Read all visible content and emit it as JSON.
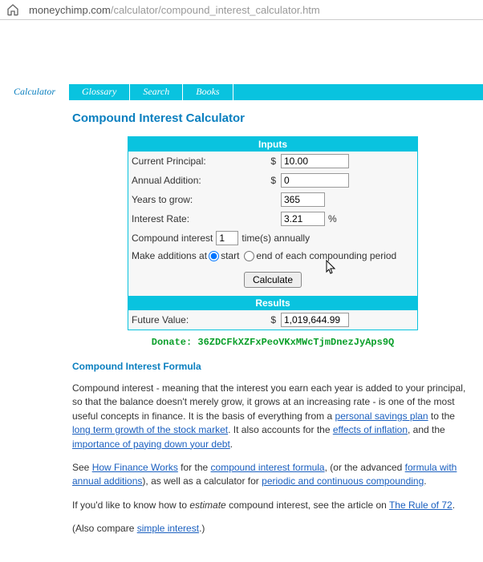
{
  "url": {
    "host": "moneychimp.com",
    "path": "/calculator/compound_interest_calculator.htm"
  },
  "nav": {
    "items": [
      "Calculator",
      "Glossary",
      "Search",
      "Books"
    ],
    "active": 0
  },
  "title": "Compound Interest Calculator",
  "inputs_header": "Inputs",
  "results_header": "Results",
  "fields": {
    "principal": {
      "label": "Current Principal:",
      "sym": "$",
      "value": "10.00"
    },
    "addition": {
      "label": "Annual Addition:",
      "sym": "$",
      "value": "0"
    },
    "years": {
      "label": "Years to grow:",
      "value": "365"
    },
    "rate": {
      "label": "Interest Rate:",
      "value": "3.21",
      "suffix": "%"
    },
    "compound": {
      "label": "Compound interest",
      "value": "1",
      "suffix": "time(s) annually"
    },
    "timing": {
      "label": "Make additions at",
      "start": "start",
      "end": "end of each compounding period"
    }
  },
  "calculate_label": "Calculate",
  "future": {
    "label": "Future Value:",
    "sym": "$",
    "value": "1,019,644.99"
  },
  "donate": "Donate: 36ZDCFkXZFxPeoVKxMWcTjmDnezJyAps9Q",
  "formula_title": "Compound Interest Formula",
  "para1": {
    "a": "Compound interest - meaning that the interest you earn each year is added to your principal, so that the balance doesn't merely grow, it grows at an increasing rate - is one of the most useful concepts in finance. It is the basis of everything from a ",
    "link1": "personal savings plan",
    "b": " to the ",
    "link2": "long term growth of the stock market",
    "c": ". It also accounts for the ",
    "link3": "effects of inflation",
    "d": ", and the ",
    "link4": "importance of paying down your debt",
    "e": "."
  },
  "para2": {
    "a": "See ",
    "link1": "How Finance Works",
    "b": " for the ",
    "link2": "compound interest formula",
    "c": ", (or the advanced ",
    "link3": "formula with annual additions",
    "d": "), as well as a calculator for ",
    "link4": "periodic and continuous compounding",
    "e": "."
  },
  "para3": {
    "a": "If you'd like to know how to ",
    "em": "estimate",
    "b": " compound interest, see the article on ",
    "link1": "The Rule of 72",
    "c": "."
  },
  "para4": {
    "a": "(Also compare ",
    "link1": "simple interest",
    "b": ".)"
  }
}
